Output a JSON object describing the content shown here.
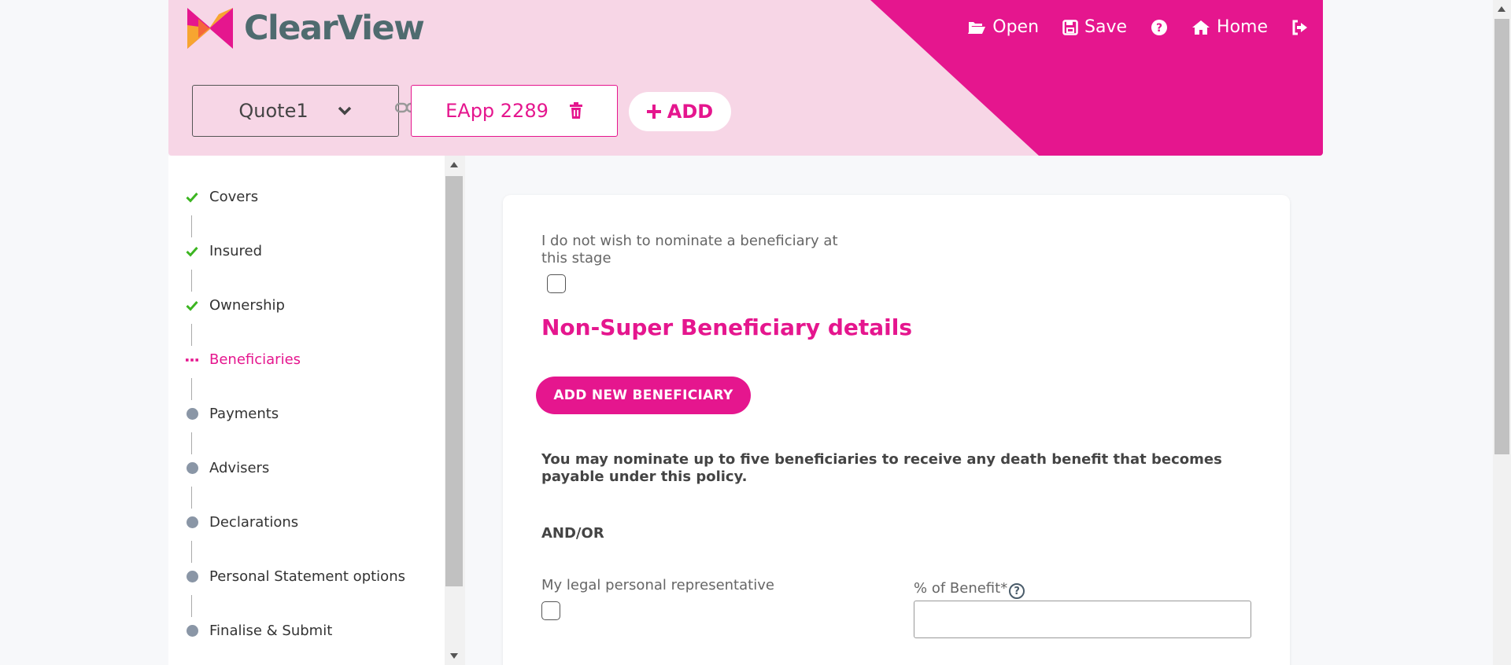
{
  "brand": {
    "name": "ClearView",
    "accent": "#e5168e",
    "header_bg": "#f7d6e6",
    "logo_text_color": "#4f6b6f"
  },
  "nav": {
    "open": "Open",
    "save": "Save",
    "home": "Home"
  },
  "toolbar": {
    "quote_value": "Quote1",
    "eapp_label": "EApp 2289",
    "add_label": "ADD"
  },
  "steps": [
    {
      "label": "Covers",
      "status": "complete"
    },
    {
      "label": "Insured",
      "status": "complete"
    },
    {
      "label": "Ownership",
      "status": "complete"
    },
    {
      "label": "Beneficiaries",
      "status": "active"
    },
    {
      "label": "Payments",
      "status": "pending"
    },
    {
      "label": "Advisers",
      "status": "pending"
    },
    {
      "label": "Declarations",
      "status": "pending"
    },
    {
      "label": "Personal Statement options",
      "status": "pending"
    },
    {
      "label": "Finalise & Submit",
      "status": "pending"
    }
  ],
  "main": {
    "nominate_label": "I do not wish to nominate a beneficiary at this stage",
    "section_title": "Non-Super Beneficiary details",
    "add_beneficiary_label": "ADD NEW BENEFICIARY",
    "info_text": "You may nominate up to five beneficiaries to receive any death benefit that becomes payable under this policy.",
    "andor": "AND/OR",
    "legal_rep_label": "My legal personal representative",
    "benefit_label": "% of Benefit*",
    "benefit_value": ""
  }
}
